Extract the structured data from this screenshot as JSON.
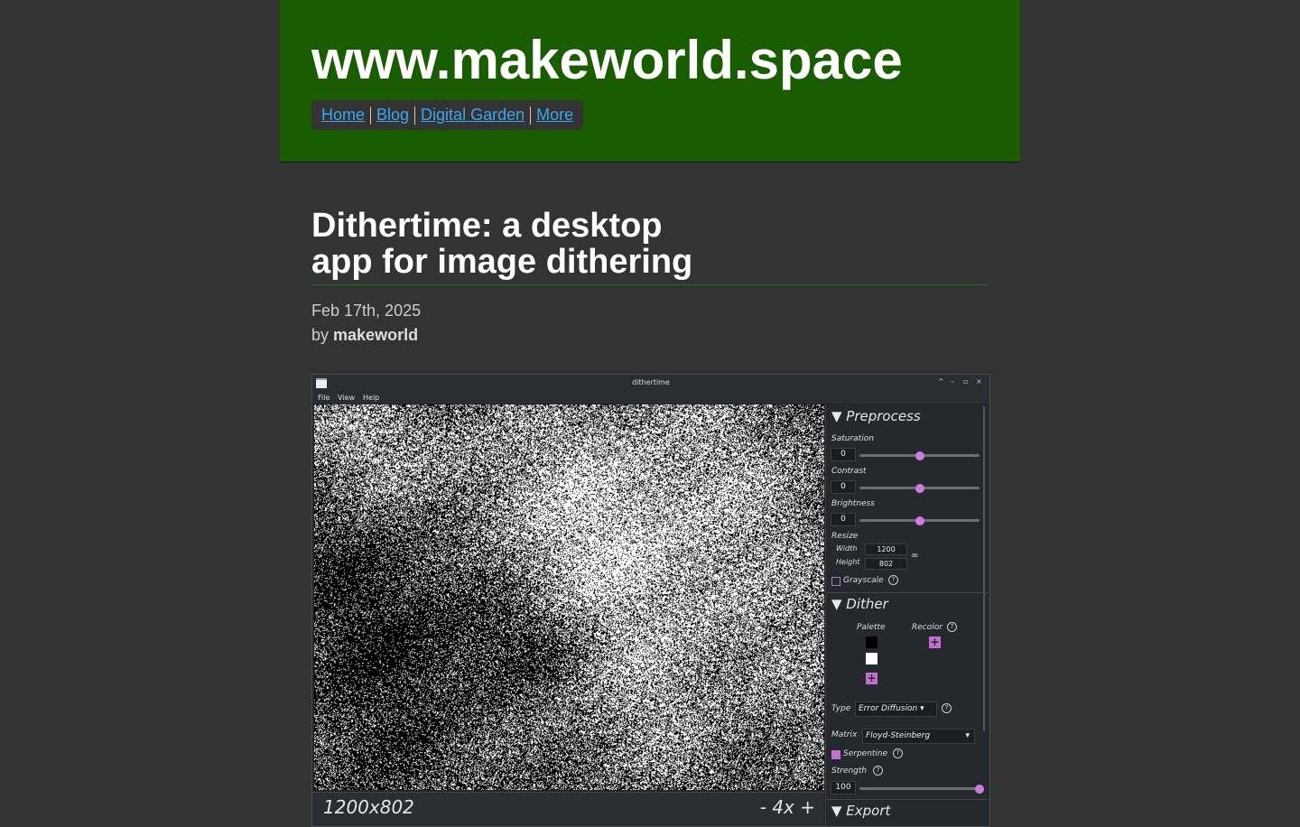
{
  "site": {
    "title": "www.makeworld.space",
    "nav": [
      "Home",
      "Blog",
      "Digital Garden",
      "More"
    ]
  },
  "post": {
    "title_line1": "Dithertime: a desktop",
    "title_line2": "app for image dithering",
    "date": "Feb 17th, 2025",
    "by": "by",
    "author": "makeworld"
  },
  "app": {
    "window_title": "dithertime",
    "window_controls": [
      "^",
      "–",
      "▫",
      "×"
    ],
    "menu": [
      "File",
      "View",
      "Help"
    ],
    "status": {
      "dimensions": "1200x802",
      "zoom": "-  4x  +"
    },
    "preprocess": {
      "heading": "▼ Preprocess",
      "saturation_label": "Saturation",
      "saturation": "0",
      "saturation_level": 0.5,
      "contrast_label": "Contrast",
      "contrast": "0",
      "contrast_level": 0.5,
      "brightness_label": "Brightness",
      "brightness": "0",
      "brightness_level": 0.5,
      "resize_label": "Resize",
      "width_label": "Width",
      "width": "1200",
      "height_label": "Height",
      "height": "802",
      "grayscale_label": "Grayscale",
      "grayscale": false
    },
    "dither": {
      "heading": "▼ Dither",
      "palette_label": "Palette",
      "recolor_label": "Recolor",
      "palette_colors": [
        "#000000",
        "#ffffff"
      ],
      "type_label": "Type",
      "type_value": "Error Diffusion",
      "matrix_label": "Matrix",
      "matrix_value": "Floyd-Steinberg",
      "serpentine_label": "Serpentine",
      "serpentine": true,
      "strength_label": "Strength",
      "strength": "100",
      "strength_level": 1.0
    },
    "export": {
      "heading": "▼ Export"
    }
  },
  "colors": {
    "header_bg": "#1a5c00",
    "page_bg": "#333333",
    "link": "#3aa6f0",
    "accent": "#d07be0"
  }
}
